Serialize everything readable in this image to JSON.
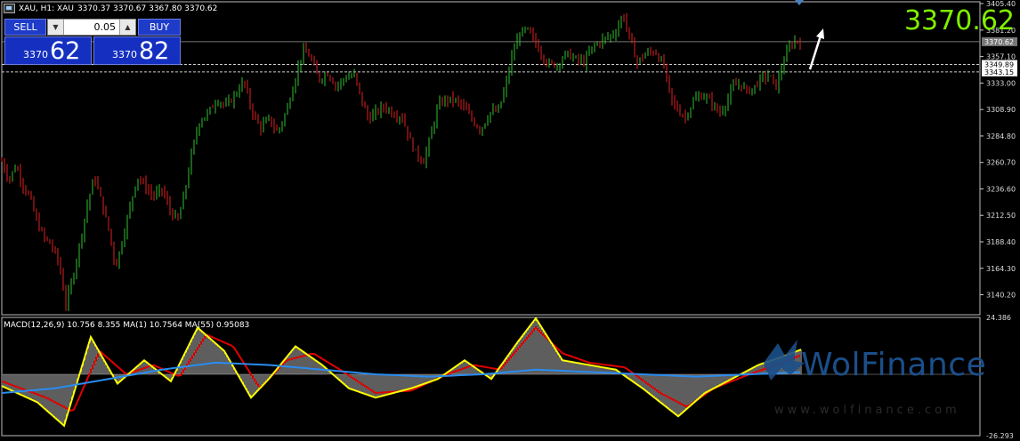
{
  "header": {
    "symbol_line": "XAU, H1: XAU",
    "ohlc": "3370.37 3370.67 3367.80 3370.62"
  },
  "trade_panel": {
    "sell_label": "SELL",
    "buy_label": "BUY",
    "lot_value": "0.05",
    "sell_small": "3370",
    "sell_big": "62",
    "buy_small": "3370",
    "buy_big": "82"
  },
  "current_price_label": "3370.62",
  "indicator_label": "MACD(12,26,9) 10.756 8.355 MA(1) 10.7564 MA(55) 0.95083",
  "watermark": {
    "brand": "WolFinance",
    "url": "www.wolfinance.com"
  },
  "colors": {
    "bull": "#2fbf2f",
    "bear": "#e02020",
    "price_highlight": "#80f000",
    "macd_line": "#ffff00",
    "signal_line": "#e00000",
    "ma_line": "#2a8cf0"
  },
  "chart_data": {
    "type": "candlestick",
    "price_axis": {
      "ticks": [
        "3405.40",
        "3381.20",
        "3357.10",
        "3333.00",
        "3308.90",
        "3284.80",
        "3260.70",
        "3236.60",
        "3212.50",
        "3188.40",
        "3164.30",
        "3140.20"
      ],
      "range": [
        3122,
        3407
      ]
    },
    "price_lines": [
      {
        "value": 3370.62,
        "label": "3370.62",
        "style": "solid"
      },
      {
        "value": 3349.89,
        "label": "3349.89",
        "style": "dashed"
      },
      {
        "value": 3343.15,
        "label": "3343.15",
        "style": "dashed"
      }
    ],
    "series": [
      {
        "name": "price",
        "points": [
          [
            0,
            3262
          ],
          [
            8,
            3245
          ],
          [
            16,
            3258
          ],
          [
            24,
            3240
          ],
          [
            32,
            3228
          ],
          [
            40,
            3205
          ],
          [
            48,
            3192
          ],
          [
            56,
            3185
          ],
          [
            64,
            3170
          ],
          [
            72,
            3132
          ],
          [
            78,
            3150
          ],
          [
            86,
            3180
          ],
          [
            96,
            3222
          ],
          [
            104,
            3248
          ],
          [
            112,
            3225
          ],
          [
            120,
            3200
          ],
          [
            128,
            3165
          ],
          [
            136,
            3192
          ],
          [
            144,
            3220
          ],
          [
            152,
            3248
          ],
          [
            160,
            3240
          ],
          [
            170,
            3230
          ],
          [
            180,
            3236
          ],
          [
            190,
            3215
          ],
          [
            198,
            3208
          ],
          [
            206,
            3235
          ],
          [
            214,
            3272
          ],
          [
            222,
            3298
          ],
          [
            232,
            3306
          ],
          [
            242,
            3318
          ],
          [
            252,
            3312
          ],
          [
            262,
            3322
          ],
          [
            272,
            3335
          ],
          [
            280,
            3310
          ],
          [
            290,
            3292
          ],
          [
            300,
            3300
          ],
          [
            310,
            3288
          ],
          [
            320,
            3308
          ],
          [
            330,
            3338
          ],
          [
            338,
            3362
          ],
          [
            346,
            3358
          ],
          [
            356,
            3336
          ],
          [
            366,
            3342
          ],
          [
            376,
            3330
          ],
          [
            386,
            3338
          ],
          [
            396,
            3340
          ],
          [
            404,
            3318
          ],
          [
            412,
            3300
          ],
          [
            420,
            3306
          ],
          [
            430,
            3312
          ],
          [
            440,
            3305
          ],
          [
            450,
            3302
          ],
          [
            458,
            3282
          ],
          [
            466,
            3268
          ],
          [
            474,
            3262
          ],
          [
            482,
            3285
          ],
          [
            490,
            3312
          ],
          [
            498,
            3318
          ],
          [
            508,
            3318
          ],
          [
            518,
            3312
          ],
          [
            528,
            3300
          ],
          [
            538,
            3290
          ],
          [
            548,
            3306
          ],
          [
            558,
            3308
          ],
          [
            566,
            3330
          ],
          [
            574,
            3360
          ],
          [
            582,
            3378
          ],
          [
            590,
            3382
          ],
          [
            598,
            3372
          ],
          [
            606,
            3360
          ],
          [
            614,
            3350
          ],
          [
            624,
            3350
          ],
          [
            634,
            3360
          ],
          [
            644,
            3355
          ],
          [
            654,
            3352
          ],
          [
            664,
            3366
          ],
          [
            674,
            3372
          ],
          [
            682,
            3375
          ],
          [
            690,
            3380
          ],
          [
            698,
            3396
          ],
          [
            706,
            3372
          ],
          [
            714,
            3352
          ],
          [
            724,
            3360
          ],
          [
            734,
            3362
          ],
          [
            744,
            3348
          ],
          [
            752,
            3318
          ],
          [
            760,
            3308
          ],
          [
            768,
            3302
          ],
          [
            778,
            3318
          ],
          [
            788,
            3322
          ],
          [
            798,
            3315
          ],
          [
            806,
            3305
          ],
          [
            814,
            3315
          ],
          [
            822,
            3330
          ],
          [
            830,
            3332
          ],
          [
            838,
            3325
          ],
          [
            846,
            3330
          ],
          [
            854,
            3338
          ],
          [
            862,
            3340
          ],
          [
            870,
            3330
          ],
          [
            878,
            3352
          ],
          [
            886,
            3368
          ],
          [
            893,
            3372
          ],
          [
            899,
            3370.6
          ]
        ]
      },
      {
        "name": "macd_histogram",
        "points": [
          [
            0,
            -5
          ],
          [
            40,
            -12
          ],
          [
            70,
            -22
          ],
          [
            100,
            16
          ],
          [
            130,
            -4
          ],
          [
            160,
            6
          ],
          [
            190,
            -3
          ],
          [
            220,
            20
          ],
          [
            250,
            10
          ],
          [
            280,
            -10
          ],
          [
            300,
            -2
          ],
          [
            330,
            12
          ],
          [
            360,
            4
          ],
          [
            390,
            -6
          ],
          [
            420,
            -10
          ],
          [
            460,
            -6
          ],
          [
            490,
            -2
          ],
          [
            520,
            6
          ],
          [
            550,
            -2
          ],
          [
            580,
            14
          ],
          [
            600,
            24
          ],
          [
            630,
            6
          ],
          [
            660,
            4
          ],
          [
            690,
            2
          ],
          [
            720,
            -6
          ],
          [
            760,
            -18
          ],
          [
            790,
            -8
          ],
          [
            820,
            -2
          ],
          [
            850,
            4
          ],
          [
            880,
            8
          ],
          [
            899,
            10.756
          ]
        ]
      },
      {
        "name": "macd_signal",
        "points": [
          [
            0,
            -3
          ],
          [
            50,
            -10
          ],
          [
            80,
            -16
          ],
          [
            110,
            10
          ],
          [
            140,
            0
          ],
          [
            170,
            4
          ],
          [
            200,
            -1
          ],
          [
            230,
            17
          ],
          [
            260,
            12
          ],
          [
            290,
            -6
          ],
          [
            320,
            6
          ],
          [
            350,
            9
          ],
          [
            380,
            2
          ],
          [
            420,
            -8
          ],
          [
            460,
            -7
          ],
          [
            500,
            0
          ],
          [
            530,
            4
          ],
          [
            560,
            2
          ],
          [
            600,
            20
          ],
          [
            630,
            9
          ],
          [
            660,
            5
          ],
          [
            700,
            3
          ],
          [
            740,
            -8
          ],
          [
            770,
            -14
          ],
          [
            800,
            -6
          ],
          [
            840,
            0
          ],
          [
            870,
            4
          ],
          [
            899,
            8.355
          ]
        ]
      },
      {
        "name": "ma55",
        "points": [
          [
            0,
            -8
          ],
          [
            60,
            -6
          ],
          [
            120,
            -2
          ],
          [
            180,
            2
          ],
          [
            240,
            5
          ],
          [
            300,
            4
          ],
          [
            360,
            2
          ],
          [
            420,
            0
          ],
          [
            480,
            -1
          ],
          [
            540,
            0
          ],
          [
            600,
            2
          ],
          [
            660,
            1
          ],
          [
            720,
            0
          ],
          [
            780,
            -1
          ],
          [
            840,
            0
          ],
          [
            899,
            0.95083
          ]
        ]
      }
    ],
    "macd_axis": {
      "ticks": [
        "24.386",
        "-26.293"
      ],
      "range": [
        -26.293,
        24.386
      ]
    }
  }
}
